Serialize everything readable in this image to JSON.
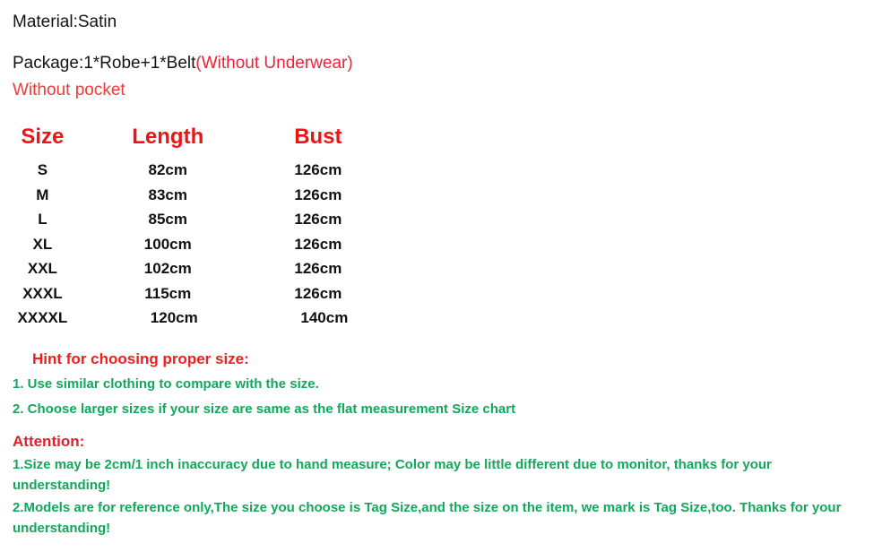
{
  "colors": {
    "red_heading": "#ef1414",
    "red_text": "#ef3a3a",
    "red_inline": "#e8243a",
    "green": "#12a85c",
    "black": "#141414",
    "background": "#ffffff"
  },
  "intro": {
    "material_line": "Material:Satin",
    "package_label": "Package:1*Robe+1*Belt",
    "package_note": "(Without Underwear)",
    "no_pocket_line": "Without pocket"
  },
  "size_chart": {
    "headers": [
      "Size",
      "Length",
      "Bust"
    ],
    "rows": [
      {
        "size": "S",
        "length": "82cm",
        "bust": "126cm"
      },
      {
        "size": "M",
        "length": "83cm",
        "bust": "126cm"
      },
      {
        "size": "L",
        "length": "85cm",
        "bust": "126cm"
      },
      {
        "size": "XL",
        "length": "100cm",
        "bust": "126cm"
      },
      {
        "size": "XXL",
        "length": "102cm",
        "bust": "126cm"
      },
      {
        "size": "XXXL",
        "length": "115cm",
        "bust": "126cm"
      },
      {
        "size": "XXXXL",
        "length": "120cm",
        "bust": "140cm"
      }
    ]
  },
  "hint": {
    "title": "Hint for choosing proper size:",
    "items": [
      "1. Use similar clothing to compare with the size.",
      "2. Choose larger sizes if your size are same as the flat measurement Size chart"
    ]
  },
  "attention": {
    "title": "Attention:",
    "items": [
      "1.Size may be 2cm/1 inch inaccuracy due to hand measure; Color may be little different   due to monitor, thanks for your understanding!",
      "2.Models are for reference only,The size you choose is Tag Size,and the size on the item,  we mark is Tag Size,too. Thanks for your understanding!"
    ]
  }
}
